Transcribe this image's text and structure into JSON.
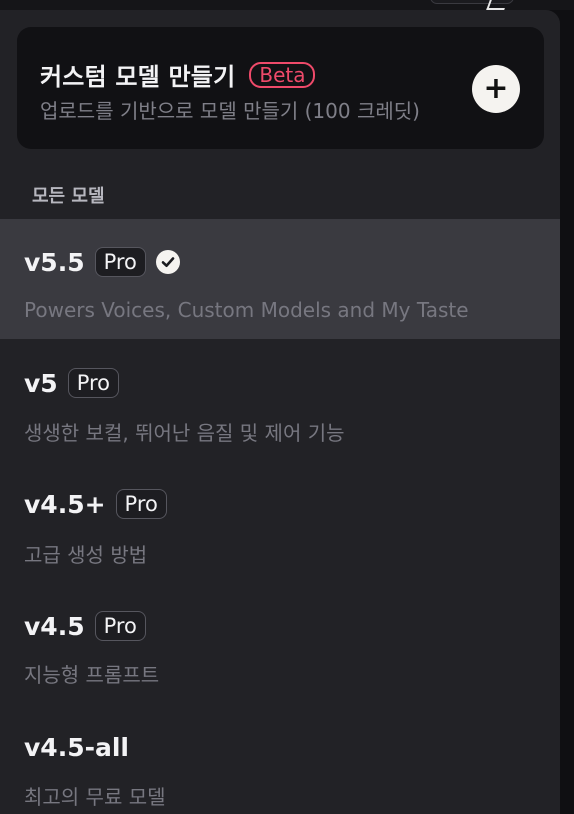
{
  "custom_model": {
    "title": "커스텀 모델 만들기",
    "badge": "Beta",
    "subtitle": "업로드를 기반으로 모델 만들기 (100 크레딧)",
    "add_icon": "plus-icon"
  },
  "section_label": "모든 모델",
  "models": [
    {
      "name": "v5.5",
      "badge": "Pro",
      "desc": "Powers Voices, Custom Models and My Taste",
      "selected": true
    },
    {
      "name": "v5",
      "badge": "Pro",
      "desc": "생생한 보컬, 뛰어난 음질 및 제어 기능",
      "selected": false
    },
    {
      "name": "v4.5+",
      "badge": "Pro",
      "desc": "고급 생성 방법",
      "selected": false
    },
    {
      "name": "v4.5",
      "badge": "Pro",
      "desc": "지능형 프롬프트",
      "selected": false
    },
    {
      "name": "v4.5-all",
      "badge": "",
      "desc": "최고의 무료 모델",
      "selected": false
    }
  ],
  "colors": {
    "panel_bg": "#222226",
    "card_bg": "#111114",
    "selected_bg": "#3a3a40",
    "beta_accent": "#ef4a6a"
  }
}
